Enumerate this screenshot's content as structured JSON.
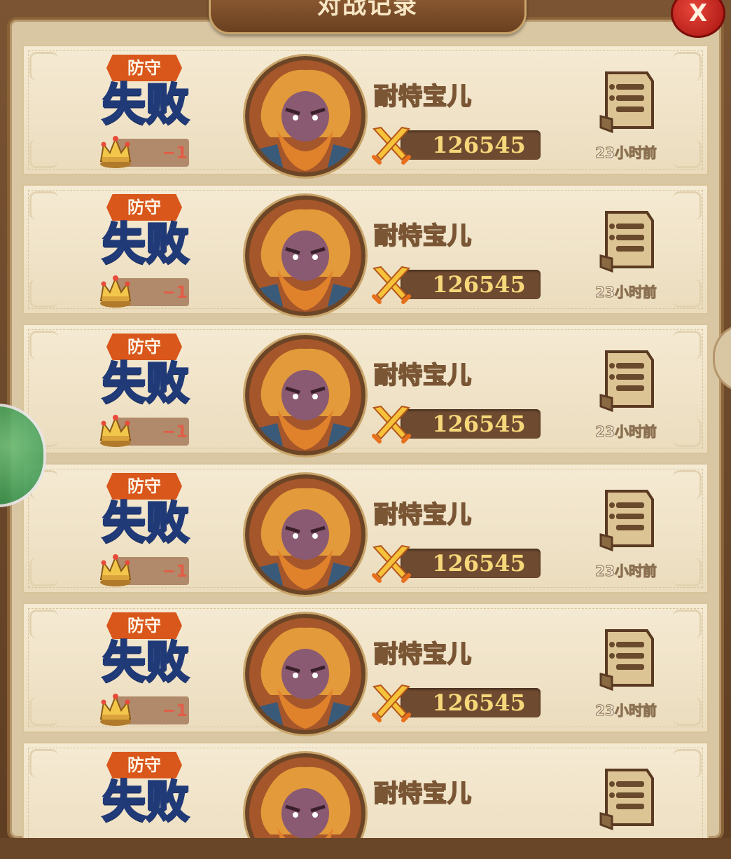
{
  "header": {
    "title": "对战记录",
    "close_label": "X"
  },
  "colors": {
    "tag_bg": "#d9571b",
    "result_text": "#4d6fb8",
    "power_text": "#f6d77a",
    "crown_delta": "#e25d47"
  },
  "records": [
    {
      "tag": "防守",
      "result": "失败",
      "crown_delta": "−1",
      "opponent_name": "耐特宝儿",
      "power": "126545",
      "time_ago": "23小时前"
    },
    {
      "tag": "防守",
      "result": "失败",
      "crown_delta": "−1",
      "opponent_name": "耐特宝儿",
      "power": "126545",
      "time_ago": "23小时前"
    },
    {
      "tag": "防守",
      "result": "失败",
      "crown_delta": "−1",
      "opponent_name": "耐特宝儿",
      "power": "126545",
      "time_ago": "23小时前"
    },
    {
      "tag": "防守",
      "result": "失败",
      "crown_delta": "−1",
      "opponent_name": "耐特宝儿",
      "power": "126545",
      "time_ago": "23小时前"
    },
    {
      "tag": "防守",
      "result": "失败",
      "crown_delta": "−1",
      "opponent_name": "耐特宝儿",
      "power": "126545",
      "time_ago": "23小时前"
    },
    {
      "tag": "防守",
      "result": "失败",
      "crown_delta": "",
      "opponent_name": "耐特宝儿",
      "power": "",
      "time_ago": ""
    }
  ],
  "icons": {
    "crown": "crown-icon",
    "power": "crossed-swords-icon",
    "replay": "scroll-record-icon",
    "avatar": "hero-portrait"
  }
}
